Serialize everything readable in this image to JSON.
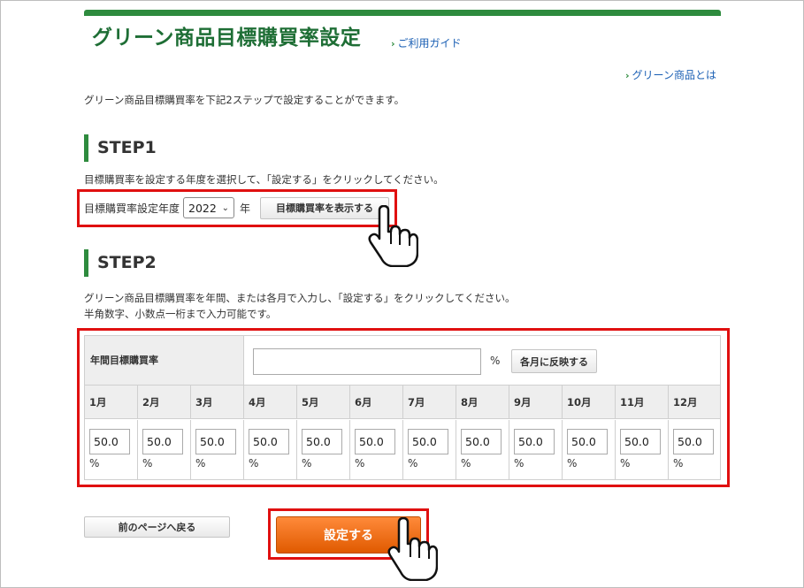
{
  "header": {
    "title": "グリーン商品目標購買率設定",
    "guide_link": "ご利用ガイド",
    "about_link": "グリーン商品とは"
  },
  "intro": "グリーン商品目標購買率を下記2ステップで設定することができます。",
  "step1": {
    "heading": "STEP1",
    "description": "目標購買率を設定する年度を選択して、「設定する」をクリックしてください。",
    "year_label": "目標購買率設定年度",
    "year_value": "2022",
    "year_unit": "年",
    "show_button": "目標購買率を表示する"
  },
  "step2": {
    "heading": "STEP2",
    "description_line1": "グリーン商品目標購買率を年間、または各月で入力し、「設定する」をクリックしてください。",
    "description_line2": "半角数字、小数点一桁まで入力可能です。",
    "annual_label": "年間目標購買率",
    "annual_value": "",
    "percent": "%",
    "reflect_button": "各月に反映する",
    "months": [
      {
        "label": "1月",
        "value": "50.0"
      },
      {
        "label": "2月",
        "value": "50.0"
      },
      {
        "label": "3月",
        "value": "50.0"
      },
      {
        "label": "4月",
        "value": "50.0"
      },
      {
        "label": "5月",
        "value": "50.0"
      },
      {
        "label": "6月",
        "value": "50.0"
      },
      {
        "label": "7月",
        "value": "50.0"
      },
      {
        "label": "8月",
        "value": "50.0"
      },
      {
        "label": "9月",
        "value": "50.0"
      },
      {
        "label": "10月",
        "value": "50.0"
      },
      {
        "label": "11月",
        "value": "50.0"
      },
      {
        "label": "12月",
        "value": "50.0"
      }
    ]
  },
  "footer": {
    "back_button": "前のページへ戻る",
    "submit_button": "設定する"
  },
  "colors": {
    "brand_green": "#2e8b3e",
    "title_green": "#1e6e35",
    "highlight_red": "#e01010",
    "submit_orange": "#f07020",
    "link_blue": "#1a5fb4"
  }
}
